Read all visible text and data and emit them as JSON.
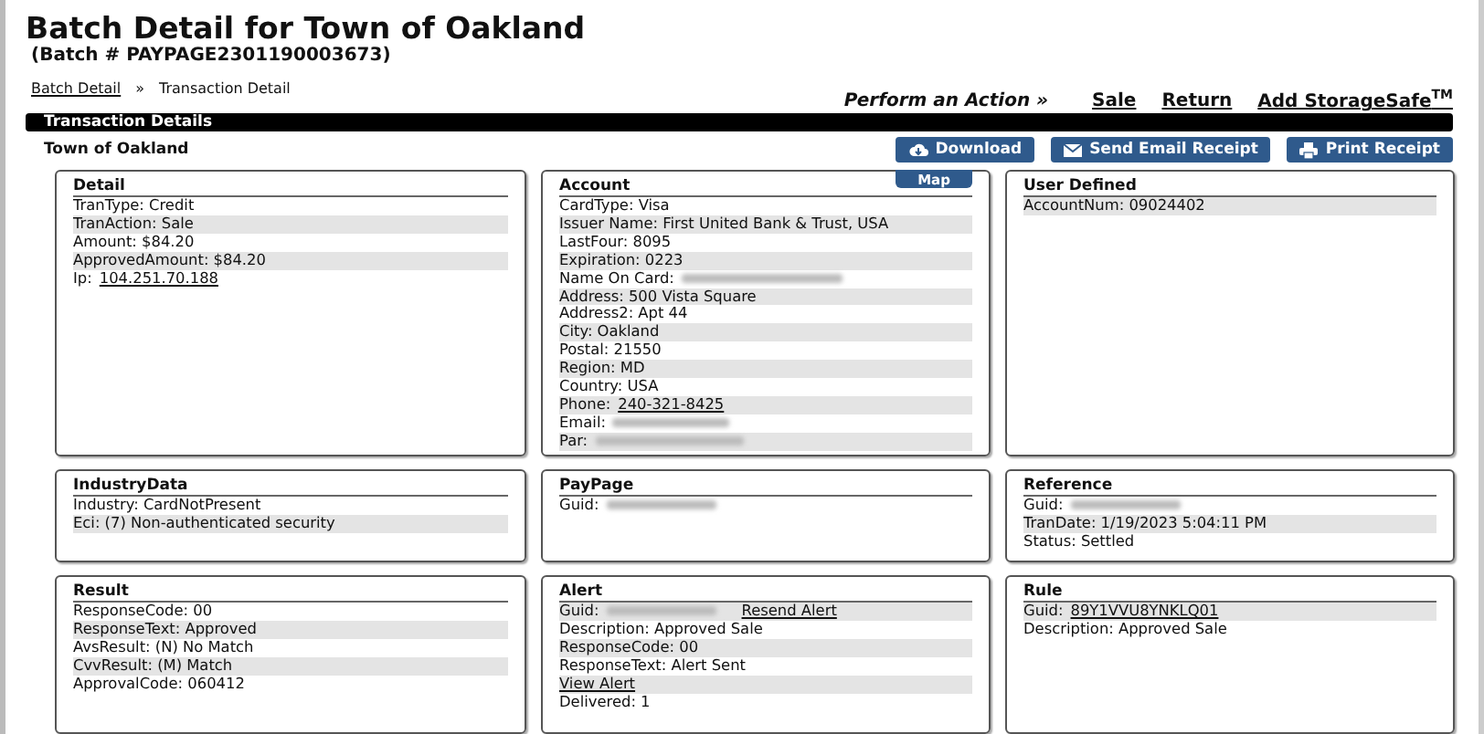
{
  "title": "Batch Detail for Town of Oakland",
  "subtitle": "(Batch # PAYPAGE2301190003673)",
  "breadcrumb": [
    {
      "label": "Batch Detail",
      "kind": "link"
    },
    {
      "label": "»",
      "kind": "separator"
    },
    {
      "label": "Transaction Detail",
      "kind": "text"
    }
  ],
  "actions": {
    "label": "Perform an Action »",
    "links": [
      "Sale",
      "Return",
      "Add StorageSafe$^{TM}$"
    ]
  },
  "section_bar": "Transaction Details",
  "merchant": "Town of Oakland",
  "buttons": [
    {
      "label": "Download",
      "kind": "download"
    },
    {
      "label": "Send Email Receipt",
      "kind": "email"
    },
    {
      "label": "Print Receipt",
      "kind": "print"
    }
  ],
  "panels": [
    {
      "title": "Detail",
      "rows": [
        {
          "label": "TranType: Credit",
          "shaded": false
        },
        {
          "label": "TranAction: Sale",
          "shaded": true
        },
        {
          "label": "Amount: $84.20",
          "shaded": false
        },
        {
          "label": "ApprovedAmount: $84.20",
          "shaded": true
        },
        {
          "label": "Ip:",
          "link": "104.251.70.188",
          "shaded": false
        }
      ]
    },
    {
      "title": "Account",
      "tab": "Map",
      "rows": [
        {
          "label": "CardType: Visa",
          "shaded": false
        },
        {
          "label": "Issuer Name: First United Bank & Trust, USA",
          "shaded": true
        },
        {
          "label": "LastFour: 8095",
          "shaded": false
        },
        {
          "label": "Expiration: 0223",
          "shaded": true
        },
        {
          "label": "Name On Card:",
          "blurred": true,
          "shaded": false
        },
        {
          "label": "Address: 500 Vista Square",
          "shaded": true
        },
        {
          "label": "Address2: Apt 44",
          "shaded": false
        },
        {
          "label": "City: Oakland",
          "shaded": true
        },
        {
          "label": "Postal: 21550",
          "shaded": false
        },
        {
          "label": "Region: MD",
          "shaded": true
        },
        {
          "label": "Country: USA",
          "shaded": false
        },
        {
          "label": "Phone:",
          "link": "240-321-8425",
          "shaded": true
        },
        {
          "label": "Email:",
          "blurred": true,
          "shaded": false
        },
        {
          "label": "Par:",
          "blurred": true,
          "shaded": true
        }
      ]
    },
    {
      "title": "User Defined",
      "rows": [
        {
          "label": "AccountNum: 09024402",
          "shaded": true
        }
      ]
    },
    {
      "title": "IndustryData",
      "rows": [
        {
          "label": "Industry: CardNotPresent",
          "shaded": false
        },
        {
          "label": "Eci: (7) Non-authenticated security",
          "shaded": true
        }
      ]
    },
    {
      "title": "PayPage",
      "rows": [
        {
          "label": "Guid:",
          "blurred": true,
          "shaded": false
        }
      ]
    },
    {
      "title": "Reference",
      "rows": [
        {
          "label": "Guid:",
          "blurred": true,
          "shaded": false
        },
        {
          "label": "TranDate: 1/19/2023 5:04:11 PM",
          "shaded": true
        },
        {
          "label": "Status: Settled",
          "shaded": false
        }
      ]
    },
    {
      "title": "Result",
      "rows": [
        {
          "label": "ResponseCode: 00",
          "shaded": false
        },
        {
          "label": "ResponseText: Approved",
          "shaded": true
        },
        {
          "label": "AvsResult: (N) No Match",
          "shaded": false
        },
        {
          "label": "CvvResult: (M) Match",
          "shaded": true
        },
        {
          "label": "ApprovalCode: 060412",
          "shaded": false
        }
      ]
    },
    {
      "title": "Alert",
      "rows": [
        {
          "label": "Guid:",
          "blurred": true,
          "action": "Resend Alert",
          "shaded": true
        },
        {
          "label": "Description: Approved Sale",
          "shaded": false
        },
        {
          "label": "ResponseCode: 00",
          "shaded": true
        },
        {
          "label": "ResponseText: Alert Sent",
          "shaded": false
        },
        {
          "link": "View Alert",
          "shaded": true
        },
        {
          "label": "Delivered: 1",
          "shaded": false
        }
      ]
    },
    {
      "title": "Rule",
      "rows": [
        {
          "label": "Guid:",
          "link": "89Y1VVU8YNKLQ01",
          "shaded": true
        },
        {
          "label": "Description: Approved Sale",
          "shaded": false
        }
      ]
    }
  ]
}
